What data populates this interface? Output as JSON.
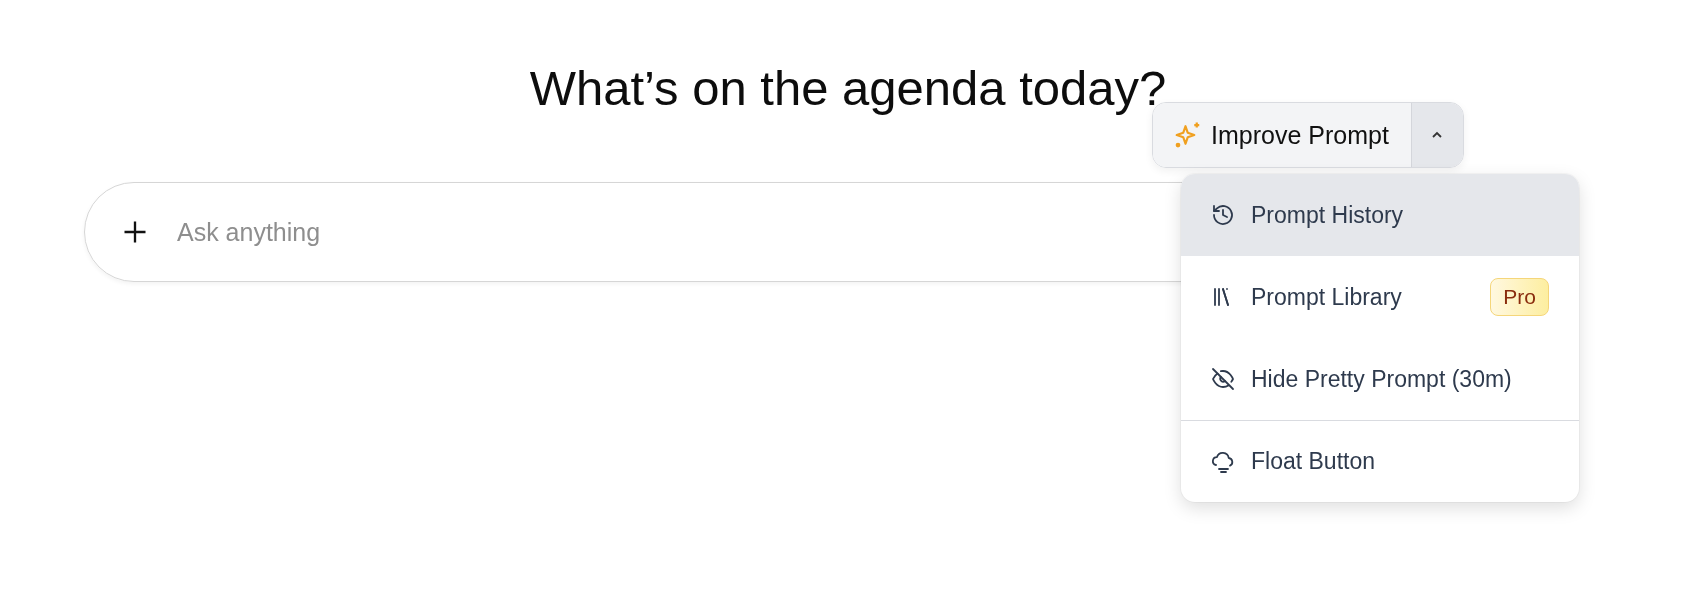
{
  "heading": "What’s on the agenda today?",
  "composer": {
    "placeholder": "Ask anything"
  },
  "improve_button": {
    "label": "Improve Prompt",
    "menu_expanded": true
  },
  "menu": {
    "items": [
      {
        "label": "Prompt History",
        "selected": true,
        "separated": false
      },
      {
        "label": "Prompt Library",
        "selected": false,
        "separated": false,
        "badge": "Pro"
      },
      {
        "label": "Hide Pretty Prompt (30m)",
        "selected": false,
        "separated": false
      },
      {
        "label": "Float Button",
        "selected": false,
        "separated": true
      }
    ]
  }
}
